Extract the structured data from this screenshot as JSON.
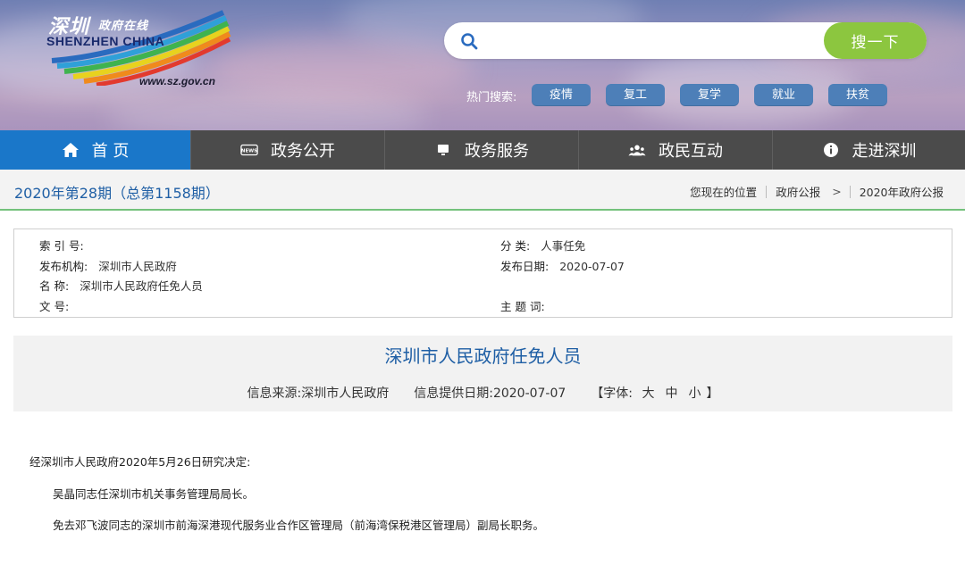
{
  "colors": {
    "nav_bg": "#4b4b4b",
    "nav_active": "#1a77c9",
    "search_button": "#8cc63f",
    "hot_tag": "#4d7fb8",
    "title_blue": "#1f5fa5",
    "issue_bar_line": "#73c17b"
  },
  "logo": {
    "cn_title": "深圳",
    "cn_subtitle": "政府在线",
    "en_title": "SHENZHEN CHINA",
    "url": "www.sz.gov.cn"
  },
  "search": {
    "placeholder": "",
    "value": "",
    "button_label": "搜一下",
    "icon": "search-icon"
  },
  "hot_search": {
    "label": "热门搜索:",
    "tags": [
      "疫情",
      "复工",
      "复学",
      "就业",
      "扶贫"
    ]
  },
  "nav": {
    "items": [
      {
        "label": "首 页",
        "icon": "home-icon"
      },
      {
        "label": "政务公开",
        "icon": "news-icon"
      },
      {
        "label": "政务服务",
        "icon": "monitor-icon"
      },
      {
        "label": "政民互动",
        "icon": "people-icon"
      },
      {
        "label": "走进深圳",
        "icon": "info-icon"
      }
    ]
  },
  "issue": {
    "title": "2020年第28期（总第1158期）",
    "breadcrumb": {
      "prefix": "您现在的位置",
      "level1": "政府公报",
      "level2": "2020年政府公报"
    }
  },
  "meta": {
    "index_key": "索 引 号:",
    "index_val": "",
    "category_key": "分 类:",
    "category_val": "人事任免",
    "publisher_key": "发布机构:",
    "publisher_val": "深圳市人民政府",
    "date_key": "发布日期:",
    "date_val": "2020-07-07",
    "name_key": "名 称:",
    "name_val": "深圳市人民政府任免人员",
    "docno_key": "文 号:",
    "docno_val": "",
    "keywords_key": "主 题 词:",
    "keywords_val": ""
  },
  "article": {
    "title": "深圳市人民政府任免人员",
    "source_label": "信息来源:",
    "source_val": "深圳市人民政府",
    "date_label": "信息提供日期:",
    "date_val": "2020-07-07",
    "font_label": "【字体:",
    "font_large": "大",
    "font_medium": "中",
    "font_small": "小",
    "font_close": "】"
  },
  "body": {
    "para1": "经深圳市人民政府2020年5月26日研究决定:",
    "para2": "吴晶同志任深圳市机关事务管理局局长。",
    "para3": "免去邓飞波同志的深圳市前海深港现代服务业合作区管理局（前海湾保税港区管理局）副局长职务。"
  }
}
